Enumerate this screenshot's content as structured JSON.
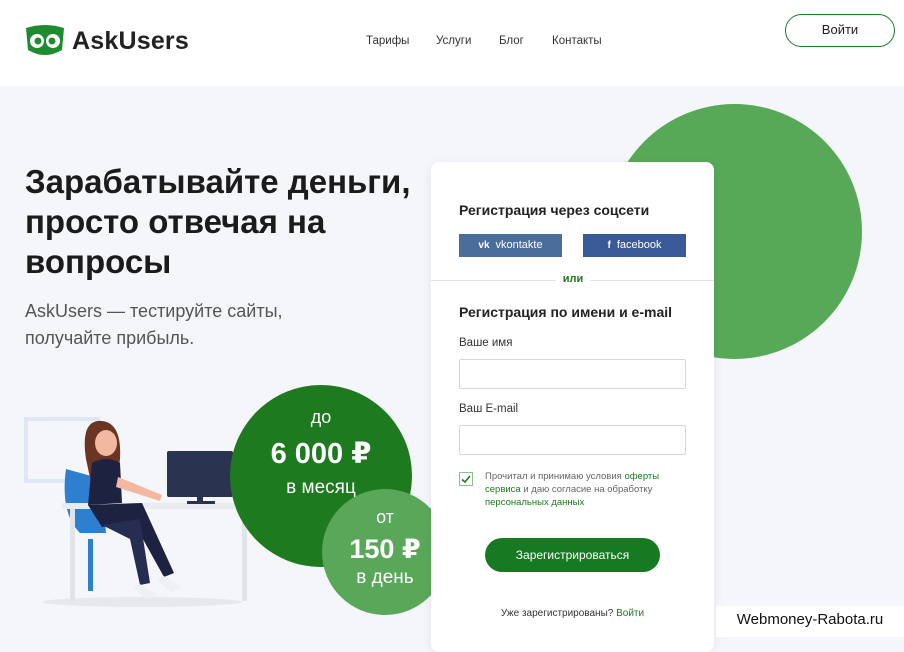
{
  "header": {
    "brand": "AskUsers",
    "nav": [
      "Тарифы",
      "Услуги",
      "Блог",
      "Контакты"
    ],
    "login_label": "Войти"
  },
  "hero": {
    "title_lines": [
      "Зарабатывайте деньги,",
      "просто отвечая на",
      "вопросы"
    ],
    "subtitle_lines": [
      "AskUsers — тестируйте сайты,",
      "получайте прибыль."
    ]
  },
  "badges": {
    "monthly": {
      "prefix": "до",
      "value": "6 000 ₽",
      "suffix": "в месяц"
    },
    "daily": {
      "prefix": "от",
      "value": "150 ₽",
      "suffix": "в день"
    }
  },
  "form": {
    "social_title": "Регистрация через соцсети",
    "vk_label": "vkontakte",
    "fb_label": "facebook",
    "or_text": "или",
    "email_title": "Регистрация по имени и e-mail",
    "name_label": "Ваше имя",
    "name_value": "",
    "email_label": "Ваш E-mail",
    "email_value": "",
    "consent_checked": true,
    "consent_text1": "Прочитал и принимаю условия ",
    "consent_link1": "оферты сервиса",
    "consent_text2": " и даю согласие на обработку ",
    "consent_link2": "персональных данных",
    "submit_label": "Зарегистрироваться",
    "already_text": "Уже зарегистрированы? ",
    "already_link": "Войти"
  },
  "watermark": "Webmoney-Rabota.ru",
  "colors": {
    "brand_green": "#1e7a1e",
    "light_green": "#57a957",
    "vk_blue": "#4a6d9c",
    "fb_blue": "#3a5a97"
  },
  "icons": [
    "owl-eyes-logo-icon",
    "vk-icon",
    "facebook-icon",
    "checkmark-icon"
  ]
}
